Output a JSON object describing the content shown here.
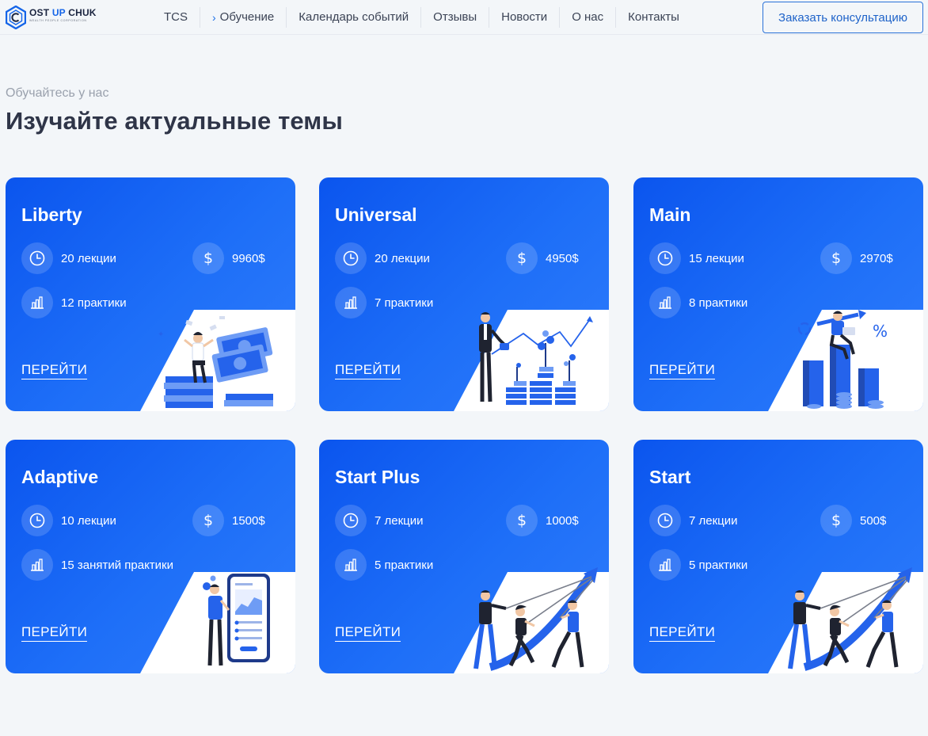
{
  "brand": {
    "name_part1": "OST ",
    "name_accent": "UP",
    "name_part2": " CHUK",
    "tagline": "WEALTH PEOPLE CORPORATION"
  },
  "nav": {
    "items": [
      "TCS",
      "Обучение",
      "Календарь событий",
      "Отзывы",
      "Новости",
      "О нас",
      "Контакты"
    ],
    "cta_label": "Заказать консультацию"
  },
  "section": {
    "kicker": "Обучайтесь у нас",
    "title": "Изучайте актуальные темы"
  },
  "icons": {
    "clock": "clock-icon",
    "dollar": "dollar-icon",
    "chart": "bar-chart-icon"
  },
  "colors": {
    "card_gradient_start": "#0b55ee",
    "card_gradient_end": "#2f7cfb",
    "accent": "#1565e8"
  },
  "cards": [
    {
      "name": "Liberty",
      "lectures": "20 лекции",
      "price": "9960$",
      "practice": "12 практики",
      "link": "ПЕРЕЙТИ",
      "illustration": "money-stack-illustration"
    },
    {
      "name": "Universal",
      "lectures": "20 лекции",
      "price": "4950$",
      "practice": "7 практики",
      "link": "ПЕРЕЙТИ",
      "illustration": "growing-coins-illustration"
    },
    {
      "name": "Main",
      "lectures": "15 лекции",
      "price": "2970$",
      "practice": "8 практики",
      "link": "ПЕРЕЙТИ",
      "illustration": "bar-chart-person-illustration"
    },
    {
      "name": "Adaptive",
      "lectures": "10 лекции",
      "price": "1500$",
      "practice": "15 занятий практики",
      "link": "ПЕРЕЙТИ",
      "illustration": "mobile-app-illustration"
    },
    {
      "name": "Start Plus",
      "lectures": "7 лекции",
      "price": "1000$",
      "practice": "5 практики",
      "link": "ПЕРЕЙТИ",
      "illustration": "team-pulling-arrow-illustration"
    },
    {
      "name": "Start",
      "lectures": "7 лекции",
      "price": "500$",
      "practice": "5 практики",
      "link": "ПЕРЕЙТИ",
      "illustration": "team-pulling-arrow-illustration"
    }
  ]
}
